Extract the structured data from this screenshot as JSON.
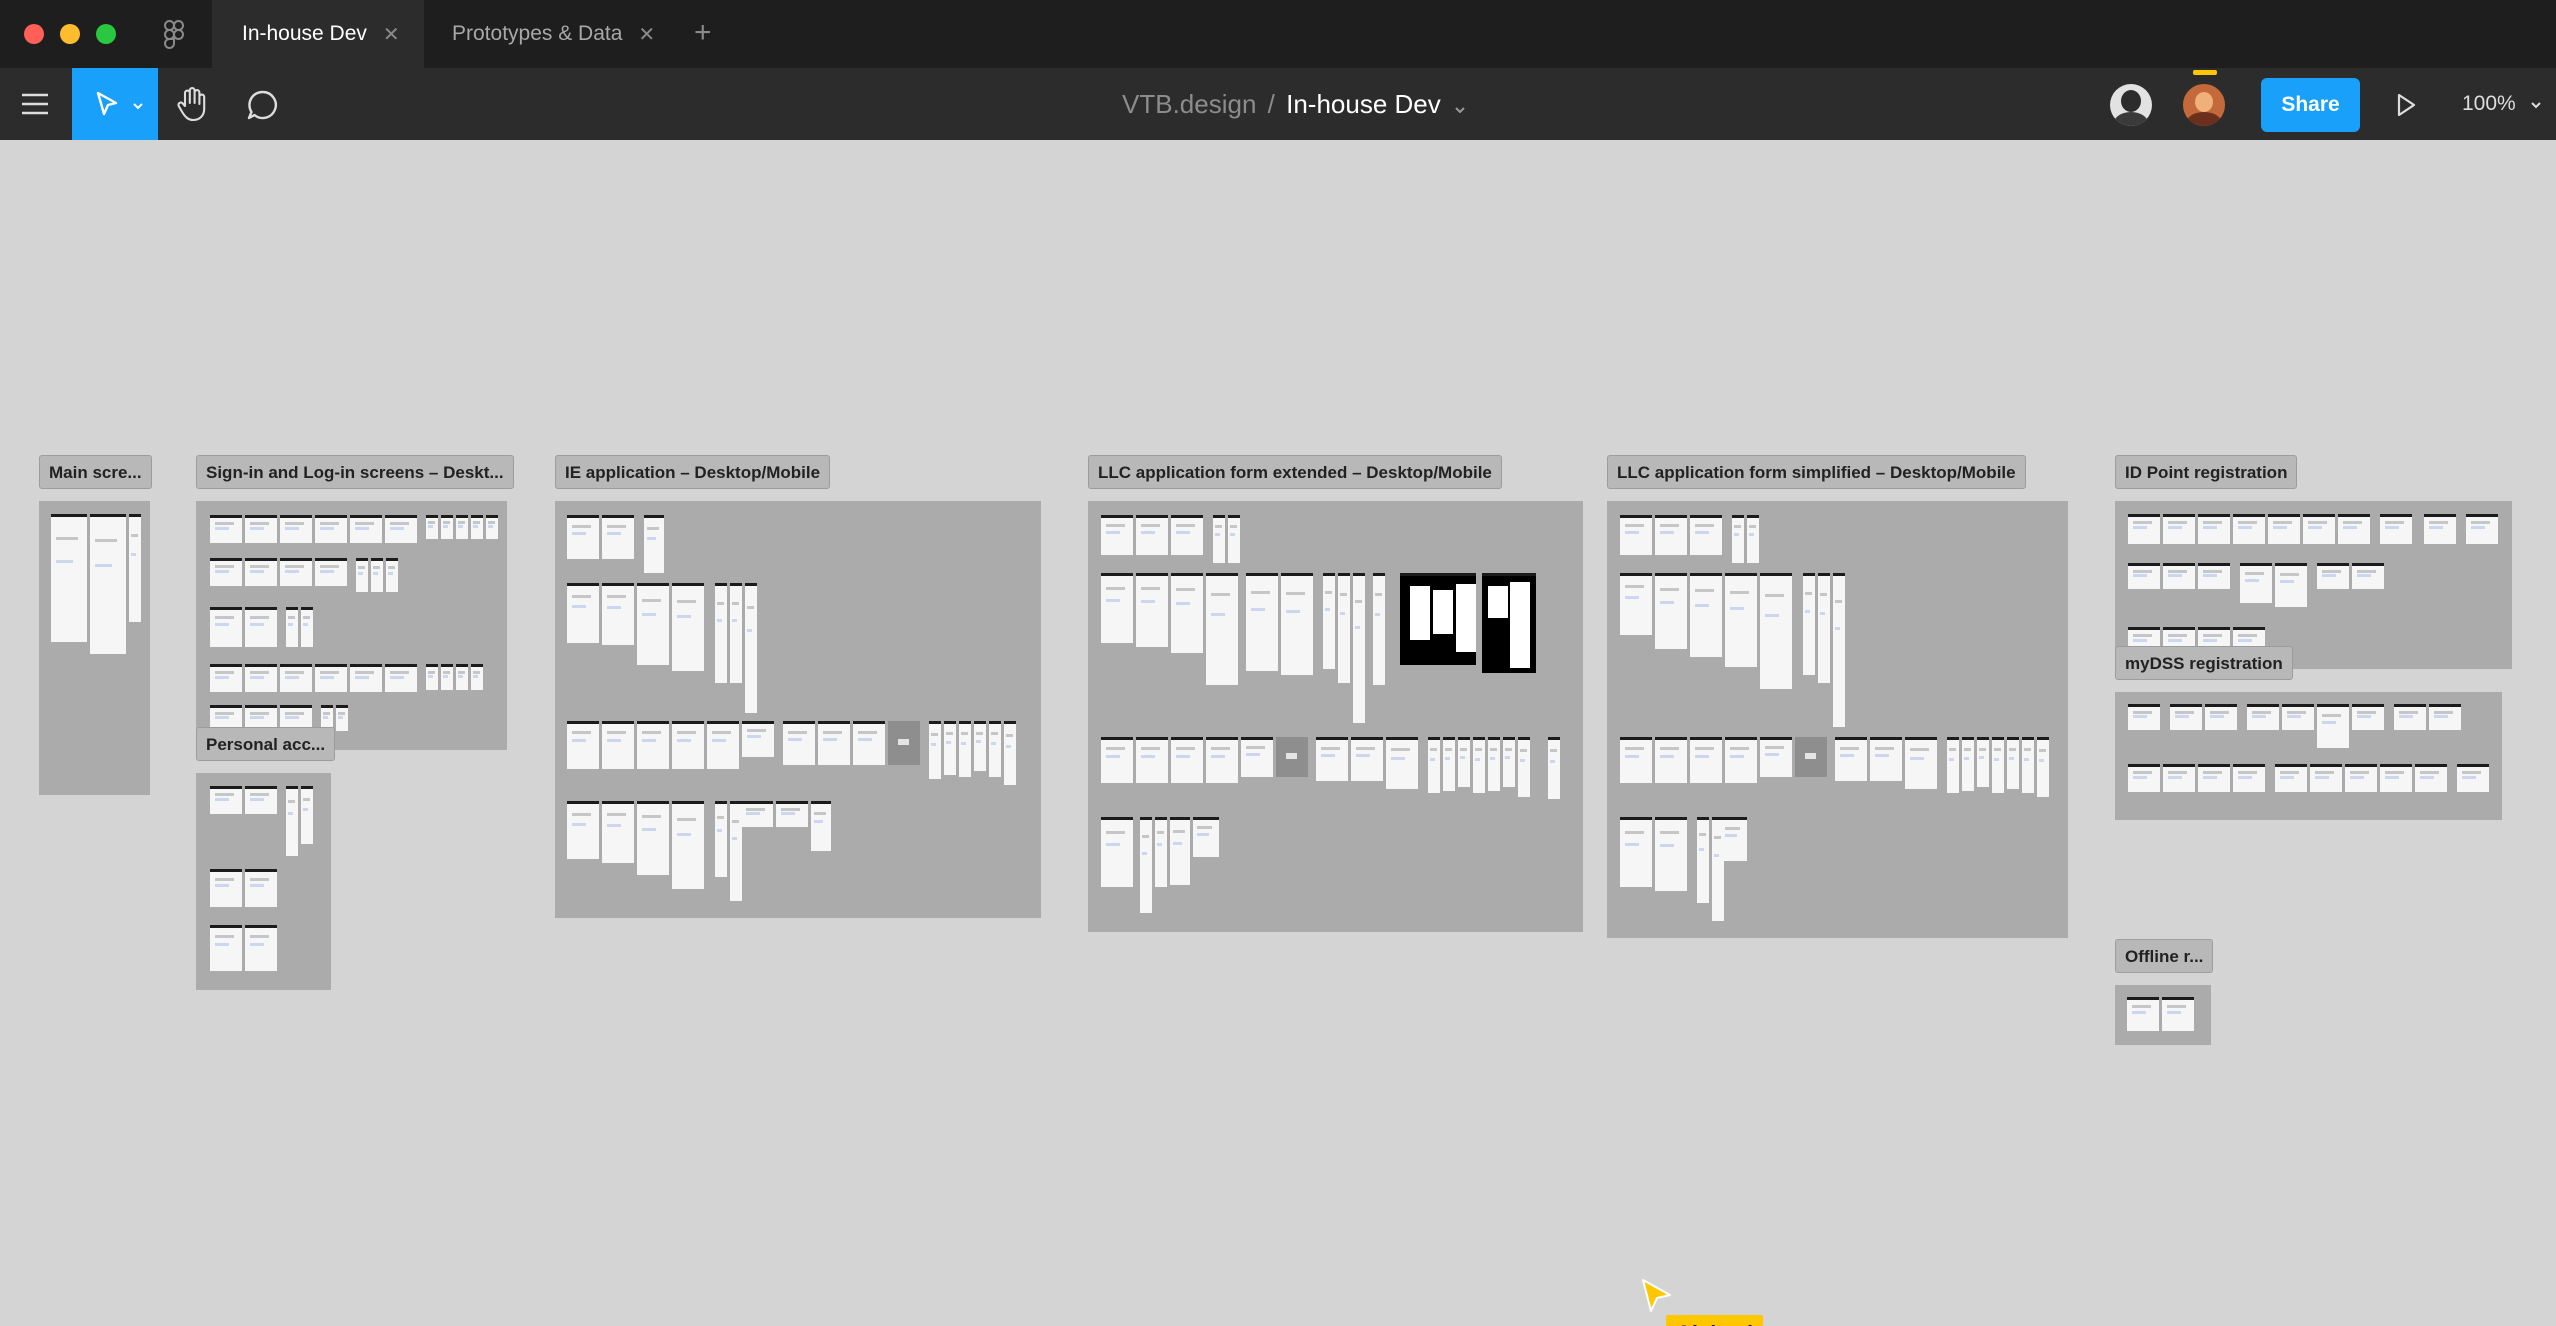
{
  "tabs": [
    {
      "label": "In-house Dev",
      "active": true
    },
    {
      "label": "Prototypes & Data",
      "active": false
    }
  ],
  "breadcrumb": {
    "team": "VTB.design",
    "separator": "/",
    "file": "In-house Dev"
  },
  "toolbar": {
    "share_label": "Share",
    "zoom": "100%"
  },
  "sections": {
    "main": "Main scre...",
    "signin": "Sign-in and Log-in screens – Deskt...",
    "personal": "Personal acc...",
    "ie": "IE application – Desktop/Mobile",
    "llc_ext": "LLC application form extended – Desktop/Mobile",
    "llc_simple": "LLC application form simplified – Desktop/Mobile",
    "idpoint": "ID Point registration",
    "mydss": "myDSS registration",
    "offline": "Offline r..."
  },
  "cursor": {
    "name": "Aleksei",
    "color": "#ffc700"
  },
  "colors": {
    "accent": "#18a0fb",
    "canvas": "#d4d4d4",
    "titlebar": "#1e1e1e",
    "toolbar": "#2c2c2c"
  },
  "icons": [
    "figma-logo-icon",
    "close-icon",
    "plus-icon",
    "menu-icon",
    "move-tool-icon",
    "hand-tool-icon",
    "comment-icon",
    "play-icon",
    "chevron-down-icon"
  ]
}
